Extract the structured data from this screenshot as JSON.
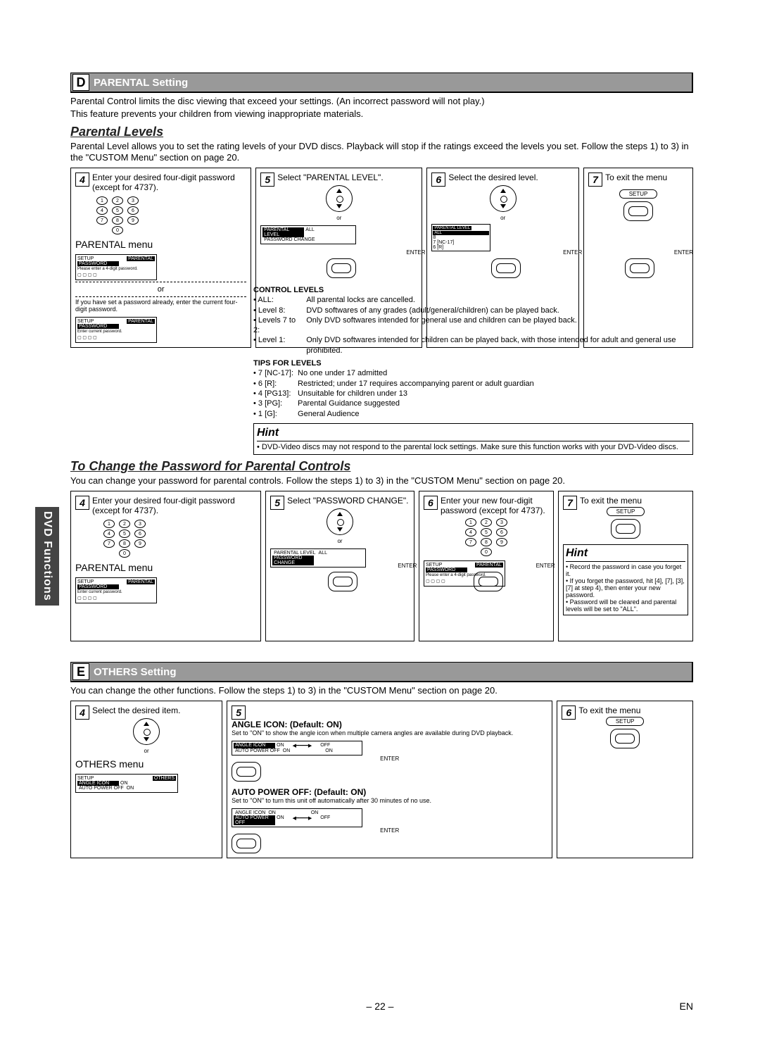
{
  "page_number": "– 22 –",
  "lang_mark": "EN",
  "side_tab": "DVD Functions",
  "sectionD": {
    "letter": "D",
    "title": "PARENTAL Setting",
    "intro1": "Parental Control limits the disc viewing that exceed your settings. (An incorrect password will not play.)",
    "intro2": "This feature prevents your children from viewing inappropriate materials.",
    "sub1": "Parental Levels",
    "sub1_intro": "Parental Level allows you to set the rating levels of your DVD discs. Playback will stop if the ratings exceed the levels you set. Follow the steps 1) to 3) in the \"CUSTOM Menu\" section on page 20.",
    "step4": "Enter your desired four-digit password (except for 4737).",
    "menu_label": "PARENTAL menu",
    "or_note1": "or",
    "or_note2": "If you have set a password already, enter the current four-digit password.",
    "step5": "Select \"PARENTAL LEVEL\".",
    "step6": "Select the desired level.",
    "step7": "To exit the menu",
    "screen_setup": "SETUP",
    "screen_tab": "PARENTAL",
    "screen_pw": "PASSWORD",
    "screen_hint1": "Please enter a 4-digit password.",
    "screen_hint2": "Enter current password.",
    "screen_plevel": "PARENTAL LEVEL",
    "screen_pwchange": "PASSWORD CHANGE",
    "screen_all": "ALL",
    "level_list": [
      "ALL",
      "8",
      "7 [NC-17]",
      "6 [R]"
    ],
    "enter_label": "ENTER",
    "or": "or",
    "control_title": "CONTROL LEVELS",
    "ctrl_rows": [
      {
        "k": "• ALL:",
        "v": "All parental locks are cancelled."
      },
      {
        "k": "• Level 8:",
        "v": "DVD softwares of any grades (adult/general/children) can be played back."
      },
      {
        "k": "• Levels 7 to 2:",
        "v": "Only DVD softwares intended for general use and children can be played back."
      },
      {
        "k": "• Level 1:",
        "v": "Only DVD softwares intended for children can be played back, with those intended for adult and general use prohibited."
      }
    ],
    "tips_title": "TIPS FOR LEVELS",
    "tips_rows": [
      {
        "k": "• 7 [NC-17]:",
        "v": "No one under 17 admitted"
      },
      {
        "k": "• 6 [R]:",
        "v": "Restricted; under 17 requires accompanying parent or adult guardian"
      },
      {
        "k": "• 4 [PG13]:",
        "v": "Unsuitable for children under 13"
      },
      {
        "k": "• 3 [PG]:",
        "v": "Parental Guidance suggested"
      },
      {
        "k": "• 1 [G]:",
        "v": "General Audience"
      }
    ],
    "hint_title": "Hint",
    "hint_body": "• DVD-Video discs may not respond to the parental lock settings. Make sure this function works with your DVD-Video discs.",
    "sub2": "To Change the Password for Parental Controls",
    "sub2_intro": "You can change your password for parental controls.  Follow the steps 1) to 3) in the \"CUSTOM Menu\" section on page 20.",
    "pw_step4": "Enter your desired four-digit password (except for 4737).",
    "pw_step5": "Select \"PASSWORD CHANGE\".",
    "pw_step6": "Enter your new four-digit password (except for 4737).",
    "pw_step7": "To exit the menu",
    "pw_hint_title": "Hint",
    "pw_hints": [
      "Record the password in case you forget it.",
      "If you forget the password, hit [4], [7], [3], [7] at step 4), then enter your new password.",
      "Password will be cleared and parental levels will be set to \"ALL\"."
    ]
  },
  "sectionE": {
    "letter": "E",
    "title": "OTHERS Setting",
    "intro": "You can change the other functions. Follow the steps 1) to 3) in the \"CUSTOM Menu\" section on page 20.",
    "step4": "Select the desired item.",
    "step5": "",
    "step6": "To exit the menu",
    "menu_label": "OTHERS menu",
    "screen_tab": "OTHERS",
    "row1": {
      "k": "ANGLE ICON",
      "v": "ON"
    },
    "row2": {
      "k": "AUTO POWER OFF",
      "v": "ON"
    },
    "angle_title": "ANGLE ICON:",
    "angle_def": "Default: ON)",
    "angle_body": "Set to \"ON\" to show the angle icon when multiple camera angles are available during DVD playback.",
    "angle_row": {
      "k": "ANGLE ICON",
      "on": "ON",
      "off": "OFF"
    },
    "apo_row_under": {
      "k": "AUTO POWER OFF",
      "on": "ON",
      "alt": "ON"
    },
    "apo_title": "AUTO POWER OFF:",
    "apo_def": "Default: ON)",
    "apo_body": "Set to \"ON\" to turn this unit off automatically after 30 minutes of no use.",
    "apo_row": {
      "k": "AUTO POWER OFF",
      "on": "ON",
      "off": "OFF"
    },
    "ai_row_above": {
      "k": "ANGLE ICON",
      "on": "ON",
      "alt": "ON"
    }
  }
}
